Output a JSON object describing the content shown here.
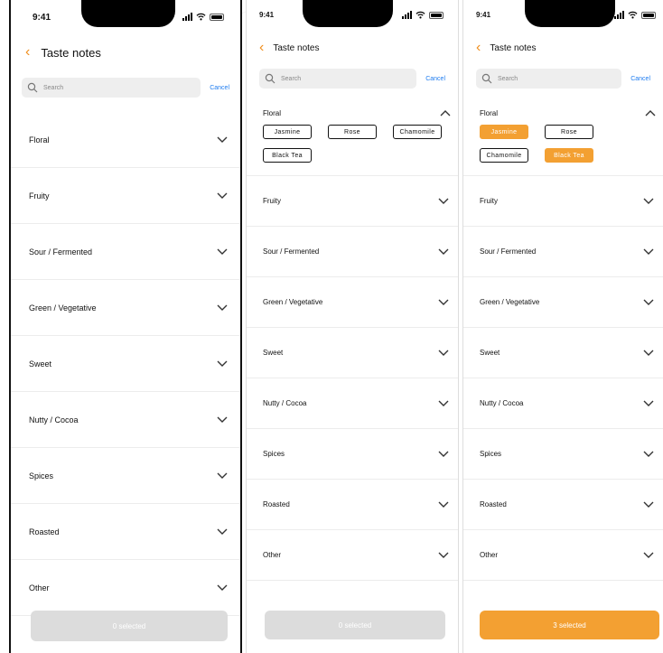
{
  "status_bar": {
    "time": "9:41"
  },
  "screens": [
    {
      "header": {
        "title": "Taste notes"
      },
      "search": {
        "placeholder": "Search",
        "cancel": "Cancel"
      },
      "categories": [
        "Floral",
        "Fruity",
        "Sour / Fermented",
        "Green / Vegetative",
        "Sweet",
        "Nutty / Cocoa",
        "Spices",
        "Roasted",
        "Other"
      ],
      "footer_button": "0 selected"
    },
    {
      "header": {
        "title": "Taste notes"
      },
      "search": {
        "placeholder": "Search",
        "cancel": "Cancel"
      },
      "expanded": {
        "label": "Floral",
        "chips": [
          "Jasmine",
          "Rose",
          "Chamomile",
          "Black Tea"
        ],
        "selected": []
      },
      "categories": [
        "Fruity",
        "Sour / Fermented",
        "Green / Vegetative",
        "Sweet",
        "Nutty / Cocoa",
        "Spices",
        "Roasted",
        "Other"
      ],
      "footer_button": "0 selected"
    },
    {
      "header": {
        "title": "Taste notes"
      },
      "search": {
        "placeholder": "Search",
        "cancel": "Cancel"
      },
      "expanded": {
        "label": "Floral",
        "chips": [
          "Jasmine",
          "Rose",
          "Chamomile",
          "Black Tea"
        ],
        "selected": [
          "Jasmine",
          "Black Tea"
        ]
      },
      "categories": [
        "Fruity",
        "Sour / Fermented",
        "Green / Vegetative",
        "Sweet",
        "Nutty / Cocoa",
        "Spices",
        "Roasted",
        "Other"
      ],
      "footer_button": "3 selected"
    }
  ],
  "colors": {
    "accent": "#f3a032",
    "back_arrow": "#f08f1e",
    "link": "#1e7cf0",
    "disabled_button": "#dcdcdc"
  },
  "icons": {
    "back": "chevron-left-icon",
    "search": "magnifier-icon",
    "expand": "chevron-down-icon",
    "collapse": "chevron-up-icon"
  }
}
